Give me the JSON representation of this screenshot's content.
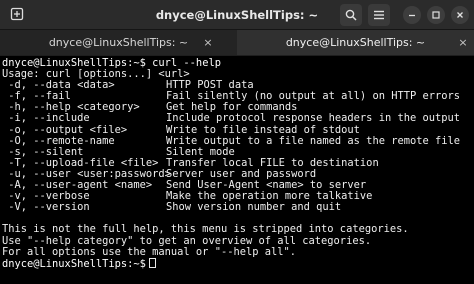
{
  "window": {
    "title": "dnyce@LinuxShellTips: ~"
  },
  "tabs": [
    {
      "label": "dnyce@LinuxShellTips: ~",
      "close": "×"
    },
    {
      "label": "dnyce@LinuxShellTips: ~",
      "close": "×"
    }
  ],
  "terminal": {
    "prompt": "dnyce@LinuxShellTips:~$",
    "command": " curl --help",
    "usage": "Usage: curl [options...] <url>",
    "options": [
      {
        "opt": " -d, --data <data>",
        "desc": "HTTP POST data"
      },
      {
        "opt": " -f, --fail",
        "desc": "Fail silently (no output at all) on HTTP errors"
      },
      {
        "opt": " -h, --help <category>",
        "desc": "Get help for commands"
      },
      {
        "opt": " -i, --include",
        "desc": "Include protocol response headers in the output"
      },
      {
        "opt": " -o, --output <file>",
        "desc": "Write to file instead of stdout"
      },
      {
        "opt": " -O, --remote-name",
        "desc": "Write output to a file named as the remote file"
      },
      {
        "opt": " -s, --silent",
        "desc": "Silent mode"
      },
      {
        "opt": " -T, --upload-file <file>",
        "desc": "Transfer local FILE to destination"
      },
      {
        "opt": " -u, --user <user:password>",
        "desc": "Server user and password"
      },
      {
        "opt": " -A, --user-agent <name>",
        "desc": "Send User-Agent <name> to server"
      },
      {
        "opt": " -v, --verbose",
        "desc": "Make the operation more talkative"
      },
      {
        "opt": " -V, --version",
        "desc": "Show version number and quit"
      }
    ],
    "footer": [
      "This is not the full help, this menu is stripped into categories.",
      "Use \"--help category\" to get an overview of all categories.",
      "For all options use the manual or \"--help all\"."
    ],
    "final_prompt": "dnyce@LinuxShellTips:~$"
  }
}
